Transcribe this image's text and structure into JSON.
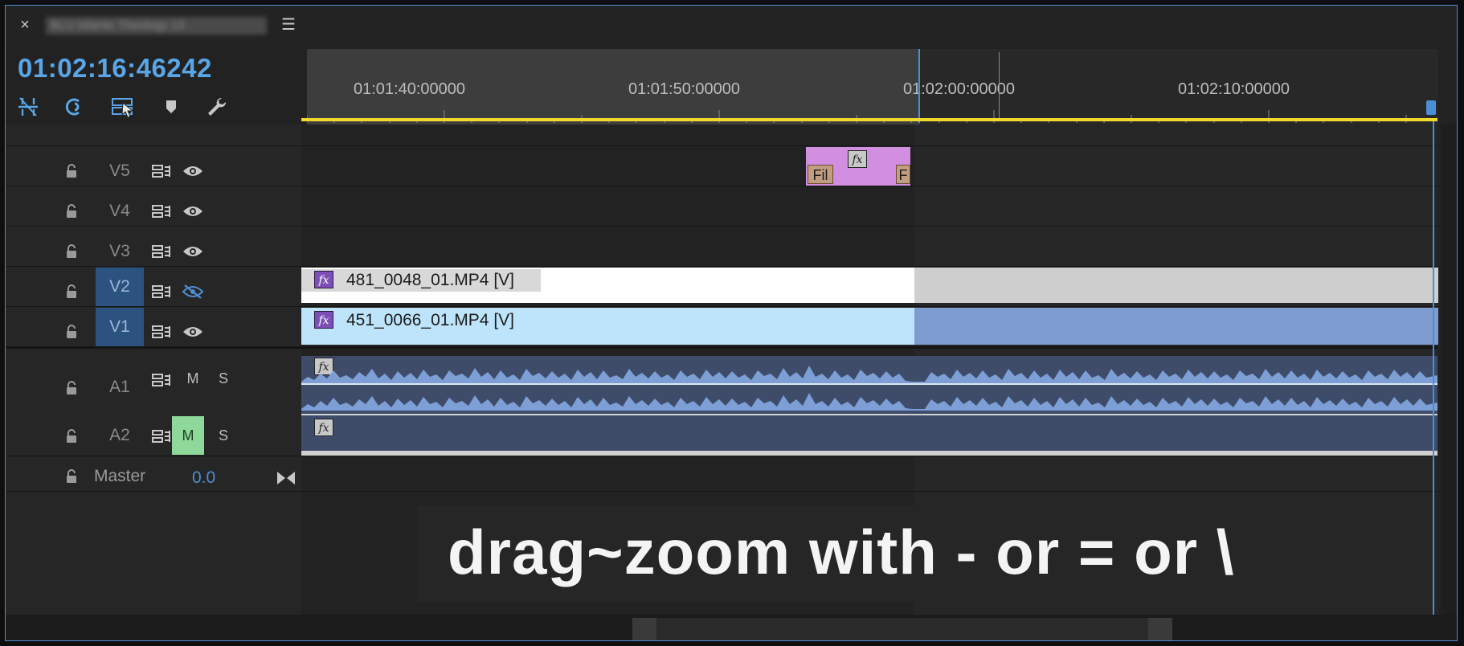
{
  "header": {
    "close_icon": "×",
    "sequence_name": "BLU Islamic Theology 13",
    "menu_icon": "☰"
  },
  "timecode": "01:02:16:46242",
  "toolbar": [
    "snap-icon",
    "linked-selection-icon",
    "insert-overwrite-icon",
    "add-marker-icon",
    "wrench-settings-icon"
  ],
  "ruler": {
    "labels": [
      "01:01:40:00000",
      "01:01:50:00000",
      "01:02:00:00000",
      "01:02:10:00000"
    ]
  },
  "tracks": {
    "video": [
      {
        "name": "V5",
        "targeted": false,
        "visible": true
      },
      {
        "name": "V4",
        "targeted": false,
        "visible": true
      },
      {
        "name": "V3",
        "targeted": false,
        "visible": true
      },
      {
        "name": "V2",
        "targeted": true,
        "visible": false
      },
      {
        "name": "V1",
        "targeted": true,
        "visible": true
      }
    ],
    "audio": [
      {
        "name": "A1",
        "mute": "M",
        "solo": "S",
        "mute_on": false
      },
      {
        "name": "A2",
        "mute": "M",
        "solo": "S",
        "mute_on": true
      }
    ],
    "master": {
      "label": "Master",
      "value": "0.0"
    }
  },
  "clips": {
    "v2": "481_0048_01.MP4 [V]",
    "v1": "451_0066_01.MP4 [V]",
    "v5_tab_left": "Fil",
    "v5_tab_right": "F",
    "fx_label": "fx"
  },
  "overlay": "drag~zoom with - or = or \\",
  "colors": {
    "accent": "#4f8dd0",
    "timecode": "#5aa5e6",
    "work_area_bar": "#f2d92a",
    "v1_clip": "#bde4fa",
    "v5_clip": "#d28ee0",
    "audio_clip": "#3e4c6a",
    "mute_on": "#8ed99a"
  }
}
